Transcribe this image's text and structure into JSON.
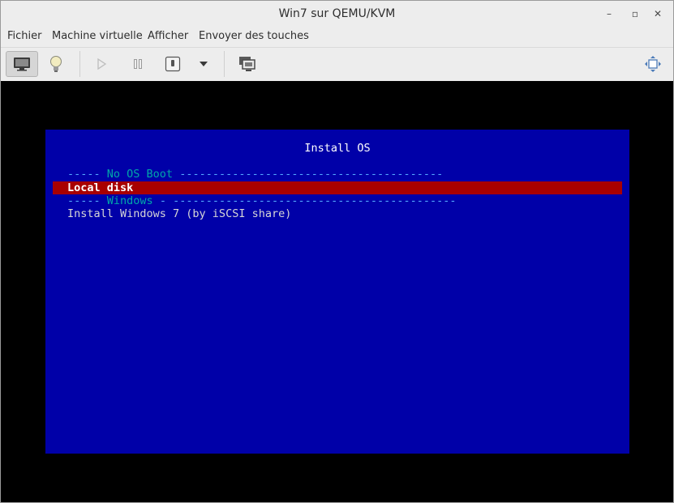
{
  "window": {
    "title": "Win7 sur QEMU/KVM",
    "minimize_glyph": "–",
    "maximize_glyph": "▫",
    "close_glyph": "✕"
  },
  "menu": {
    "items": [
      "Fichier",
      "Machine virtuelle",
      "Afficher",
      "Envoyer des touches"
    ]
  },
  "toolbar": {
    "buttons": [
      "console-icon",
      "details-lightbulb-icon",
      "run-icon",
      "pause-icon",
      "shutdown-icon",
      "shutdown-dropdown-icon",
      "snapshots-icon",
      "fullscreen-icon"
    ]
  },
  "boot_menu": {
    "title": "Install OS",
    "colors": {
      "background": "#0000a8",
      "selected": "#a80000",
      "separator": "#00a8a8",
      "text": "#d6d6d6"
    },
    "lines": [
      {
        "type": "separator",
        "prefix": "----- ",
        "label": "No OS Boot",
        "suffix": " ----------------------------------------"
      },
      {
        "type": "selected",
        "text": "Local disk"
      },
      {
        "type": "separator",
        "prefix": "----- ",
        "label": "Windows",
        "suffix": " - -------------------------------------------"
      },
      {
        "type": "item",
        "text": "Install Windows 7 (by iSCSI share)"
      }
    ]
  }
}
